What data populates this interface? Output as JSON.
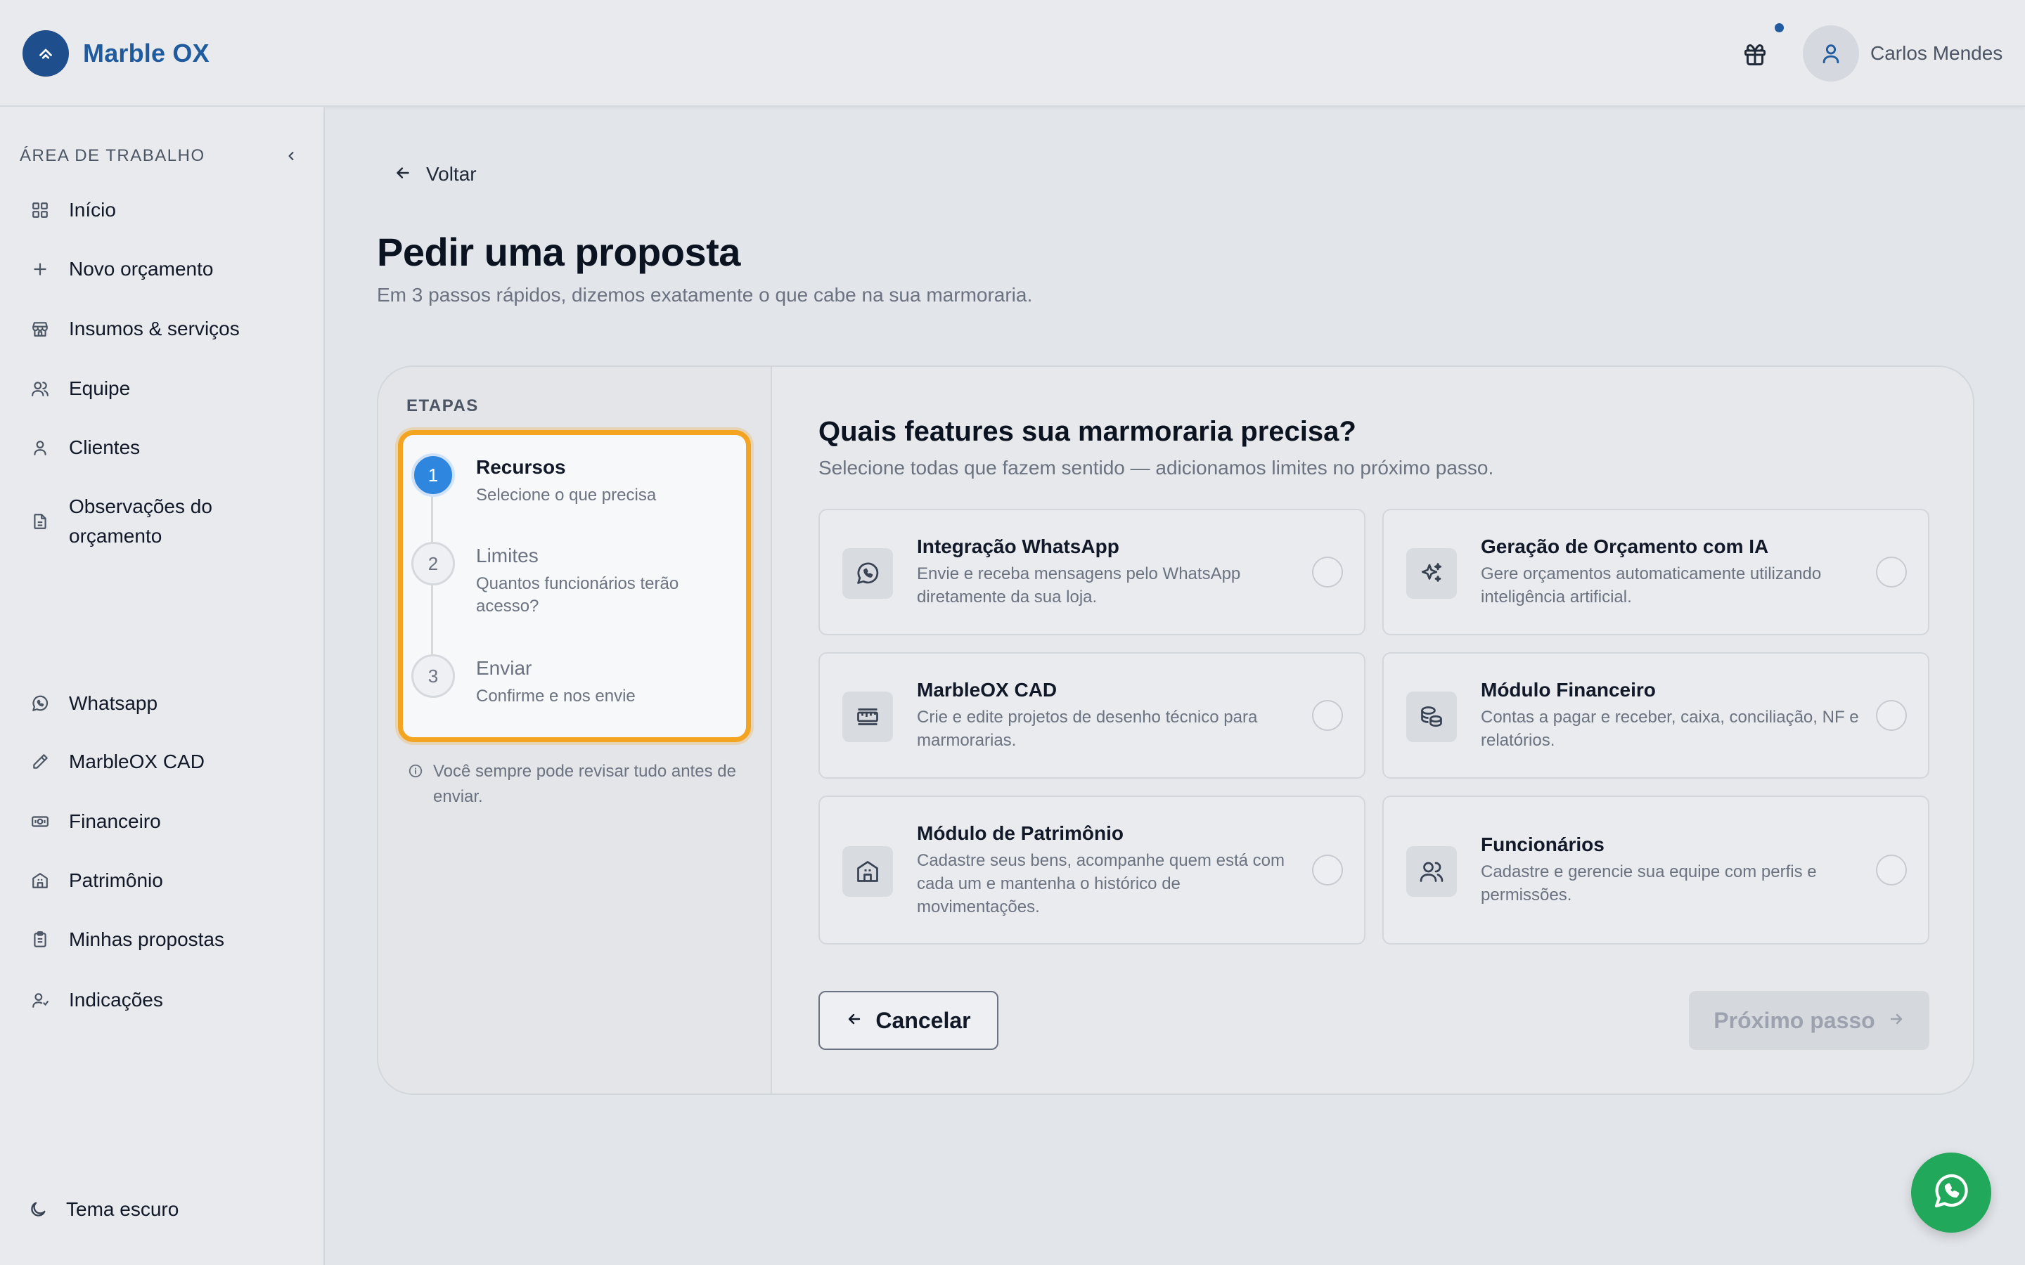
{
  "header": {
    "brand_name": "Marble OX",
    "user_name": "Carlos Mendes"
  },
  "sidebar": {
    "section_title": "ÁREA DE TRABALHO",
    "items": [
      {
        "label": "Início",
        "icon": "grid-icon"
      },
      {
        "label": "Novo orçamento",
        "icon": "plus-icon"
      },
      {
        "label": "Insumos & serviços",
        "icon": "store-icon"
      },
      {
        "label": "Equipe",
        "icon": "users-icon"
      },
      {
        "label": "Clientes",
        "icon": "user-icon"
      },
      {
        "label": "Observações do orçamento",
        "icon": "document-icon"
      },
      {
        "label": "Whatsapp",
        "icon": "whatsapp-icon"
      },
      {
        "label": "MarbleOX CAD",
        "icon": "pencil-icon"
      },
      {
        "label": "Financeiro",
        "icon": "money-icon"
      },
      {
        "label": "Patrimônio",
        "icon": "building-icon"
      },
      {
        "label": "Minhas propostas",
        "icon": "clipboard-icon"
      },
      {
        "label": "Indicações",
        "icon": "user-referral-icon"
      }
    ],
    "footer_label": "Tema escuro"
  },
  "main": {
    "back_label": "Voltar",
    "title": "Pedir uma proposta",
    "subtitle": "Em 3 passos rápidos, dizemos exatamente o que cabe na sua marmoraria."
  },
  "steps": {
    "heading": "ETAPAS",
    "items": [
      {
        "number": "1",
        "title": "Recursos",
        "desc": "Selecione o que precisa",
        "active": true
      },
      {
        "number": "2",
        "title": "Limites",
        "desc": "Quantos funcionários terão acesso?",
        "active": false
      },
      {
        "number": "3",
        "title": "Enviar",
        "desc": "Confirme e nos envie",
        "active": false
      }
    ],
    "note": "Você sempre pode revisar tudo antes de enviar."
  },
  "features": {
    "title": "Quais features sua marmoraria precisa?",
    "subtitle": "Selecione todas que fazem sentido — adicionamos limites no próximo passo.",
    "items": [
      {
        "title": "Integração WhatsApp",
        "desc": "Envie e receba mensagens pelo WhatsApp diretamente da sua loja.",
        "icon": "whatsapp-icon",
        "selected": false
      },
      {
        "title": "Geração de Orçamento com IA",
        "desc": "Gere orçamentos automaticamente utilizando inteligência artificial.",
        "icon": "sparkles-icon",
        "selected": false
      },
      {
        "title": "MarbleOX CAD",
        "desc": "Crie e edite projetos de desenho técnico para marmorarias.",
        "icon": "ruler-icon",
        "selected": false
      },
      {
        "title": "Módulo Financeiro",
        "desc": "Contas a pagar e receber, caixa, conciliação, NF e relatórios.",
        "icon": "coins-icon",
        "selected": false
      },
      {
        "title": "Módulo de Patrimônio",
        "desc": "Cadastre seus bens, acompanhe quem está com cada um e mantenha o histórico de movimentações.",
        "icon": "building-icon",
        "selected": false
      },
      {
        "title": "Funcionários",
        "desc": "Cadastre e gerencie sua equipe com perfis e permissões.",
        "icon": "users-icon",
        "selected": false
      }
    ]
  },
  "actions": {
    "cancel_label": "Cancelar",
    "next_label": "Próximo passo"
  },
  "colors": {
    "accent": "#2e86de",
    "brand": "#1f5b9e",
    "highlight": "#f3a421",
    "whatsapp": "#21a85a"
  }
}
